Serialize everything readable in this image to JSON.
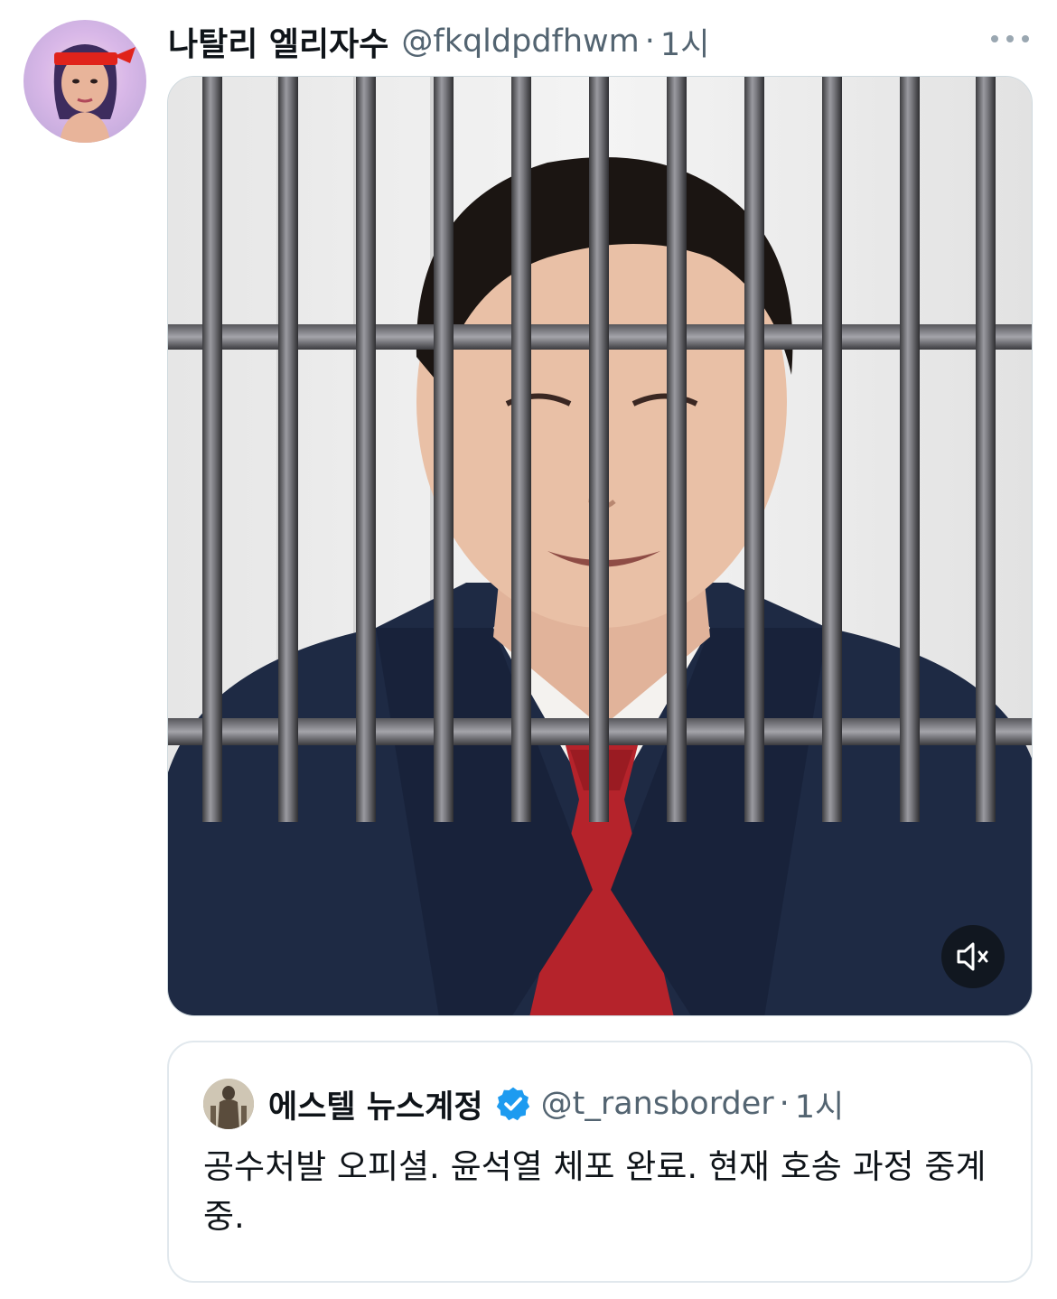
{
  "tweet": {
    "display_name": "나탈리 엘리자수",
    "handle": "@fkqldpdfhwm",
    "separator": "·",
    "time": "1시",
    "more_icon": "more-horizontal-icon",
    "media": {
      "type": "video",
      "muted": true,
      "mute_icon": "volume-muted-icon"
    }
  },
  "quoted_tweet": {
    "display_name": "에스텔 뉴스계정",
    "verified": true,
    "verified_color": "#1d9bf0",
    "handle": "@t_ransborder",
    "separator": "·",
    "time": "1시",
    "text": "공수처발 오피셜. 윤석열 체포 완료. 현재 호송 과정 중계중."
  },
  "colors": {
    "text_primary": "#0f1419",
    "text_secondary": "#536471",
    "border": "#e1e8ed"
  }
}
